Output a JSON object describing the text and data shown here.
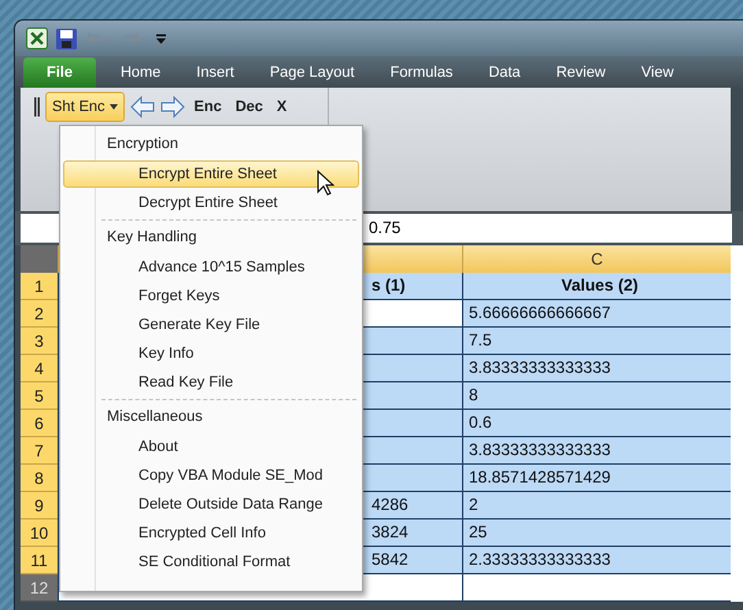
{
  "ribbon_tabs": [
    {
      "label": "File",
      "kind": "file"
    },
    {
      "label": "Home",
      "kind": "tab"
    },
    {
      "label": "Insert",
      "kind": "tab"
    },
    {
      "label": "Page Layout",
      "kind": "tab"
    },
    {
      "label": "Formulas",
      "kind": "tab"
    },
    {
      "label": "Data",
      "kind": "tab"
    },
    {
      "label": "Review",
      "kind": "tab"
    },
    {
      "label": "View",
      "kind": "tab"
    }
  ],
  "toolbar": {
    "dropdown": {
      "label": "Sht Enc",
      "open": true
    },
    "buttons": [
      "Enc",
      "Dec",
      "X"
    ]
  },
  "formula_bar": {
    "value": "0.75"
  },
  "columns": [
    {
      "label": "C"
    }
  ],
  "rows": [
    {
      "number": "1",
      "b": "s (1)",
      "c": "Values (2)",
      "kind": "header",
      "selected": true
    },
    {
      "number": "2",
      "c": "5.66666666666667",
      "selected": true,
      "active": true
    },
    {
      "number": "3",
      "c": "7.5",
      "selected": true
    },
    {
      "number": "4",
      "c": "3.83333333333333",
      "selected": true
    },
    {
      "number": "5",
      "c": "8",
      "selected": true
    },
    {
      "number": "6",
      "c": "0.6",
      "selected": true
    },
    {
      "number": "7",
      "c": "3.83333333333333",
      "selected": true
    },
    {
      "number": "8",
      "c": "18.8571428571429",
      "selected": true
    },
    {
      "number": "9",
      "b": "4286",
      "c": "2",
      "selected": true
    },
    {
      "number": "10",
      "b": "3824",
      "c": "25",
      "selected": true
    },
    {
      "number": "11",
      "b": "5842",
      "c": "2.33333333333333",
      "selected": true
    },
    {
      "number": "12",
      "selected": false
    }
  ],
  "menu": [
    {
      "heading": "Encryption",
      "items": [
        {
          "label": "Encrypt Entire Sheet",
          "selected": true
        },
        {
          "label": "Decrypt Entire Sheet",
          "selected": false
        }
      ]
    },
    {
      "heading": "Key Handling",
      "items": [
        {
          "label": "Advance 10^15 Samples",
          "selected": false
        },
        {
          "label": "Forget Keys",
          "selected": false
        },
        {
          "label": "Generate Key File",
          "selected": false
        },
        {
          "label": "Key Info",
          "selected": false
        },
        {
          "label": "Read Key File",
          "selected": false
        }
      ]
    },
    {
      "heading": "Miscellaneous",
      "items": [
        {
          "label": "About",
          "selected": false
        },
        {
          "label": "Copy VBA Module SE_Mod",
          "selected": false
        },
        {
          "label": "Delete Outside Data Range",
          "selected": false
        },
        {
          "label": "Encrypted Cell Info",
          "selected": false
        },
        {
          "label": "SE Conditional Format",
          "selected": false
        }
      ]
    }
  ]
}
